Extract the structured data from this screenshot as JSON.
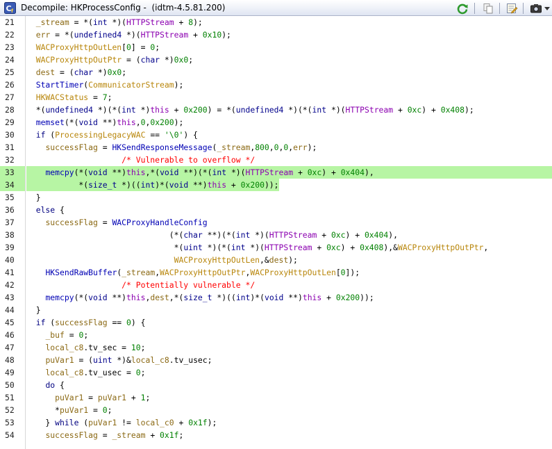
{
  "window": {
    "title": "Decompile: HKProcessConfig -  (idtm-4.5.81.200)",
    "app_icon": "cf-decompile-icon",
    "toolbar": [
      {
        "name": "refresh-icon",
        "color": "#2e9a2e"
      },
      {
        "name": "copy-icon",
        "color": "#8a8a8a"
      },
      {
        "name": "edit-function-icon",
        "color": "#c89b2a"
      },
      {
        "name": "snapshot-icon",
        "color": "#444444"
      }
    ]
  },
  "highlight": {
    "color": "#b7f5a4",
    "lines": [
      33,
      34
    ]
  },
  "code_lines": [
    {
      "n": "21",
      "tokens": [
        [
          "  ",
          "pl"
        ],
        [
          "_stream",
          "lv"
        ],
        [
          " = *(",
          "op"
        ],
        [
          "int",
          "ty"
        ],
        [
          " *)(",
          "op"
        ],
        [
          "HTTPStream",
          "pm"
        ],
        [
          " + ",
          "op"
        ],
        [
          "8",
          "num"
        ],
        [
          ");",
          "op"
        ]
      ]
    },
    {
      "n": "22",
      "tokens": [
        [
          "  ",
          "pl"
        ],
        [
          "err",
          "lv"
        ],
        [
          " = *(",
          "op"
        ],
        [
          "undefined4",
          "ty"
        ],
        [
          " *)(",
          "op"
        ],
        [
          "HTTPStream",
          "pm"
        ],
        [
          " + ",
          "op"
        ],
        [
          "0x10",
          "num"
        ],
        [
          ");",
          "op"
        ]
      ]
    },
    {
      "n": "23",
      "tokens": [
        [
          "  ",
          "pl"
        ],
        [
          "WACProxyHttpOutLen",
          "gv"
        ],
        [
          "[",
          "op"
        ],
        [
          "0",
          "num"
        ],
        [
          "] = ",
          "op"
        ],
        [
          "0",
          "num"
        ],
        [
          ";",
          "op"
        ]
      ]
    },
    {
      "n": "24",
      "tokens": [
        [
          "  ",
          "pl"
        ],
        [
          "WACProxyHttpOutPtr",
          "gv"
        ],
        [
          " = (",
          "op"
        ],
        [
          "char",
          "ty"
        ],
        [
          " *)",
          "op"
        ],
        [
          "0x0",
          "num"
        ],
        [
          ";",
          "op"
        ]
      ]
    },
    {
      "n": "25",
      "tokens": [
        [
          "  ",
          "pl"
        ],
        [
          "dest",
          "lv"
        ],
        [
          " = (",
          "op"
        ],
        [
          "char",
          "ty"
        ],
        [
          " *)",
          "op"
        ],
        [
          "0x0",
          "num"
        ],
        [
          ";",
          "op"
        ]
      ]
    },
    {
      "n": "26",
      "tokens": [
        [
          "  ",
          "pl"
        ],
        [
          "StartTimer",
          "fn"
        ],
        [
          "(",
          "op"
        ],
        [
          "CommunicatorStream",
          "gv"
        ],
        [
          ");",
          "op"
        ]
      ]
    },
    {
      "n": "27",
      "tokens": [
        [
          "  ",
          "pl"
        ],
        [
          "HKWACStatus",
          "gv"
        ],
        [
          " = ",
          "op"
        ],
        [
          "7",
          "num"
        ],
        [
          ";",
          "op"
        ]
      ]
    },
    {
      "n": "28",
      "tokens": [
        [
          "  *(",
          "op"
        ],
        [
          "undefined4",
          "ty"
        ],
        [
          " *)(*(",
          "op"
        ],
        [
          "int",
          "ty"
        ],
        [
          " *)",
          "op"
        ],
        [
          "this",
          "pm"
        ],
        [
          " + ",
          "op"
        ],
        [
          "0x200",
          "num"
        ],
        [
          ") = *(",
          "op"
        ],
        [
          "undefined4",
          "ty"
        ],
        [
          " *)(*(",
          "op"
        ],
        [
          "int",
          "ty"
        ],
        [
          " *)(",
          "op"
        ],
        [
          "HTTPStream",
          "pm"
        ],
        [
          " + ",
          "op"
        ],
        [
          "0xc",
          "num"
        ],
        [
          ") + ",
          "op"
        ],
        [
          "0x408",
          "num"
        ],
        [
          ");",
          "op"
        ]
      ]
    },
    {
      "n": "29",
      "tokens": [
        [
          "  ",
          "pl"
        ],
        [
          "memset",
          "fn"
        ],
        [
          "(*(",
          "op"
        ],
        [
          "void",
          "ty"
        ],
        [
          " **)",
          "op"
        ],
        [
          "this",
          "pm"
        ],
        [
          ",",
          "op"
        ],
        [
          "0",
          "num"
        ],
        [
          ",",
          "op"
        ],
        [
          "0x200",
          "num"
        ],
        [
          ");",
          "op"
        ]
      ]
    },
    {
      "n": "30",
      "tokens": [
        [
          "  ",
          "pl"
        ],
        [
          "if",
          "kw"
        ],
        [
          " (",
          "op"
        ],
        [
          "ProcessingLegacyWAC",
          "gv"
        ],
        [
          " == ",
          "op"
        ],
        [
          "'\\0'",
          "str"
        ],
        [
          ") {",
          "op"
        ]
      ]
    },
    {
      "n": "31",
      "tokens": [
        [
          "    ",
          "pl"
        ],
        [
          "successFlag",
          "lv"
        ],
        [
          " = ",
          "op"
        ],
        [
          "HKSendResponseMessage",
          "fn"
        ],
        [
          "(",
          "op"
        ],
        [
          "_stream",
          "lv"
        ],
        [
          ",",
          "op"
        ],
        [
          "800",
          "num"
        ],
        [
          ",",
          "op"
        ],
        [
          "0",
          "num"
        ],
        [
          ",",
          "op"
        ],
        [
          "0",
          "num"
        ],
        [
          ",",
          "op"
        ],
        [
          "err",
          "lv"
        ],
        [
          ");",
          "op"
        ]
      ]
    },
    {
      "n": "32",
      "tokens": [
        [
          "                    ",
          "pl"
        ],
        [
          "/* Vulnerable to overflow */",
          "cm"
        ]
      ]
    },
    {
      "n": "33",
      "tokens": [
        [
          "    ",
          "pl"
        ],
        [
          "memcpy",
          "fn"
        ],
        [
          "(*(",
          "op"
        ],
        [
          "void",
          "ty"
        ],
        [
          " **)",
          "op"
        ],
        [
          "this",
          "pm"
        ],
        [
          ",*(",
          "op"
        ],
        [
          "void",
          "ty"
        ],
        [
          " **)(*(",
          "op"
        ],
        [
          "int",
          "ty"
        ],
        [
          " *)(",
          "op"
        ],
        [
          "HTTPStream",
          "pm"
        ],
        [
          " + ",
          "op"
        ],
        [
          "0xc",
          "num"
        ],
        [
          ") + ",
          "op"
        ],
        [
          "0x404",
          "num"
        ],
        [
          "),",
          "op"
        ]
      ]
    },
    {
      "n": "34",
      "tokens": [
        [
          "           *(",
          "op"
        ],
        [
          "size_t",
          "ty"
        ],
        [
          " *)((",
          "op"
        ],
        [
          "int",
          "ty"
        ],
        [
          ")*(",
          "op"
        ],
        [
          "void",
          "ty"
        ],
        [
          " **)",
          "op"
        ],
        [
          "this",
          "pm"
        ],
        [
          " + ",
          "op"
        ],
        [
          "0x200",
          "num"
        ],
        [
          "));",
          "op"
        ]
      ]
    },
    {
      "n": "35",
      "tokens": [
        [
          "  }",
          "op"
        ]
      ]
    },
    {
      "n": "36",
      "tokens": [
        [
          "  ",
          "pl"
        ],
        [
          "else",
          "kw"
        ],
        [
          " {",
          "op"
        ]
      ]
    },
    {
      "n": "37",
      "tokens": [
        [
          "    ",
          "pl"
        ],
        [
          "successFlag",
          "lv"
        ],
        [
          " = ",
          "op"
        ],
        [
          "WACProxyHandleConfig",
          "fn"
        ]
      ]
    },
    {
      "n": "38",
      "tokens": [
        [
          "                              (*(",
          "op"
        ],
        [
          "char",
          "ty"
        ],
        [
          " **)(*(",
          "op"
        ],
        [
          "int",
          "ty"
        ],
        [
          " *)(",
          "op"
        ],
        [
          "HTTPStream",
          "pm"
        ],
        [
          " + ",
          "op"
        ],
        [
          "0xc",
          "num"
        ],
        [
          ") + ",
          "op"
        ],
        [
          "0x404",
          "num"
        ],
        [
          "),",
          "op"
        ]
      ]
    },
    {
      "n": "39",
      "tokens": [
        [
          "                               *(",
          "op"
        ],
        [
          "uint",
          "ty"
        ],
        [
          " *)(*(",
          "op"
        ],
        [
          "int",
          "ty"
        ],
        [
          " *)(",
          "op"
        ],
        [
          "HTTPStream",
          "pm"
        ],
        [
          " + ",
          "op"
        ],
        [
          "0xc",
          "num"
        ],
        [
          ") + ",
          "op"
        ],
        [
          "0x408",
          "num"
        ],
        [
          "),&",
          "op"
        ],
        [
          "WACProxyHttpOutPtr",
          "gv"
        ],
        [
          ",",
          "op"
        ]
      ]
    },
    {
      "n": "40",
      "tokens": [
        [
          "                               ",
          "pl"
        ],
        [
          "WACProxyHttpOutLen",
          "gv"
        ],
        [
          ",&",
          "op"
        ],
        [
          "dest",
          "lv"
        ],
        [
          ");",
          "op"
        ]
      ]
    },
    {
      "n": "41",
      "tokens": [
        [
          "    ",
          "pl"
        ],
        [
          "HKSendRawBuffer",
          "fn"
        ],
        [
          "(",
          "op"
        ],
        [
          "_stream",
          "lv"
        ],
        [
          ",",
          "op"
        ],
        [
          "WACProxyHttpOutPtr",
          "gv"
        ],
        [
          ",",
          "op"
        ],
        [
          "WACProxyHttpOutLen",
          "gv"
        ],
        [
          "[",
          "op"
        ],
        [
          "0",
          "num"
        ],
        [
          "]);",
          "op"
        ]
      ]
    },
    {
      "n": "42",
      "tokens": [
        [
          "                    ",
          "pl"
        ],
        [
          "/* Potentially vulnerable */",
          "cm"
        ]
      ]
    },
    {
      "n": "43",
      "tokens": [
        [
          "    ",
          "pl"
        ],
        [
          "memcpy",
          "fn"
        ],
        [
          "(*(",
          "op"
        ],
        [
          "void",
          "ty"
        ],
        [
          " **)",
          "op"
        ],
        [
          "this",
          "pm"
        ],
        [
          ",",
          "op"
        ],
        [
          "dest",
          "lv"
        ],
        [
          ",*(",
          "op"
        ],
        [
          "size_t",
          "ty"
        ],
        [
          " *)((",
          "op"
        ],
        [
          "int",
          "ty"
        ],
        [
          ")*(",
          "op"
        ],
        [
          "void",
          "ty"
        ],
        [
          " **)",
          "op"
        ],
        [
          "this",
          "pm"
        ],
        [
          " + ",
          "op"
        ],
        [
          "0x200",
          "num"
        ],
        [
          "));",
          "op"
        ]
      ]
    },
    {
      "n": "44",
      "tokens": [
        [
          "  }",
          "op"
        ]
      ]
    },
    {
      "n": "45",
      "tokens": [
        [
          "  ",
          "pl"
        ],
        [
          "if",
          "kw"
        ],
        [
          " (",
          "op"
        ],
        [
          "successFlag",
          "lv"
        ],
        [
          " == ",
          "op"
        ],
        [
          "0",
          "num"
        ],
        [
          ") {",
          "op"
        ]
      ]
    },
    {
      "n": "46",
      "tokens": [
        [
          "    ",
          "pl"
        ],
        [
          "_buf",
          "lv"
        ],
        [
          " = ",
          "op"
        ],
        [
          "0",
          "num"
        ],
        [
          ";",
          "op"
        ]
      ]
    },
    {
      "n": "47",
      "tokens": [
        [
          "    ",
          "pl"
        ],
        [
          "local_c8",
          "lv"
        ],
        [
          ".tv_sec = ",
          "op"
        ],
        [
          "10",
          "num"
        ],
        [
          ";",
          "op"
        ]
      ]
    },
    {
      "n": "48",
      "tokens": [
        [
          "    ",
          "pl"
        ],
        [
          "puVar1",
          "lv"
        ],
        [
          " = (",
          "op"
        ],
        [
          "uint",
          "ty"
        ],
        [
          " *)&",
          "op"
        ],
        [
          "local_c8",
          "lv"
        ],
        [
          ".tv_usec;",
          "op"
        ]
      ]
    },
    {
      "n": "49",
      "tokens": [
        [
          "    ",
          "pl"
        ],
        [
          "local_c8",
          "lv"
        ],
        [
          ".tv_usec = ",
          "op"
        ],
        [
          "0",
          "num"
        ],
        [
          ";",
          "op"
        ]
      ]
    },
    {
      "n": "50",
      "tokens": [
        [
          "    ",
          "pl"
        ],
        [
          "do",
          "kw"
        ],
        [
          " {",
          "op"
        ]
      ]
    },
    {
      "n": "51",
      "tokens": [
        [
          "      ",
          "pl"
        ],
        [
          "puVar1",
          "lv"
        ],
        [
          " = ",
          "op"
        ],
        [
          "puVar1",
          "lv"
        ],
        [
          " + ",
          "op"
        ],
        [
          "1",
          "num"
        ],
        [
          ";",
          "op"
        ]
      ]
    },
    {
      "n": "52",
      "tokens": [
        [
          "      *",
          "op"
        ],
        [
          "puVar1",
          "lv"
        ],
        [
          " = ",
          "op"
        ],
        [
          "0",
          "num"
        ],
        [
          ";",
          "op"
        ]
      ]
    },
    {
      "n": "53",
      "tokens": [
        [
          "    } ",
          "op"
        ],
        [
          "while",
          "kw"
        ],
        [
          " (",
          "op"
        ],
        [
          "puVar1",
          "lv"
        ],
        [
          " != ",
          "op"
        ],
        [
          "local_c0",
          "lv"
        ],
        [
          " + ",
          "op"
        ],
        [
          "0x1f",
          "num"
        ],
        [
          ");",
          "op"
        ]
      ]
    },
    {
      "n": "54",
      "tokens": [
        [
          "    ",
          "pl"
        ],
        [
          "successFlag",
          "lv"
        ],
        [
          " = ",
          "op"
        ],
        [
          "_stream",
          "lv"
        ],
        [
          " + ",
          "op"
        ],
        [
          "0x1f",
          "num"
        ],
        [
          ";",
          "op"
        ]
      ]
    }
  ]
}
